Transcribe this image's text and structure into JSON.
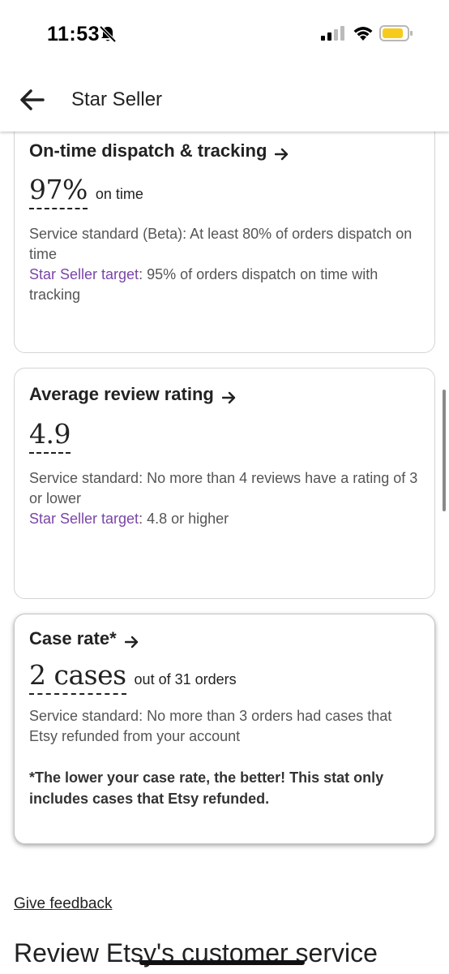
{
  "status_bar": {
    "time": "11:53"
  },
  "header": {
    "title": "Star Seller"
  },
  "cards": [
    {
      "title": "On-time dispatch & tracking",
      "metric_value": "97%",
      "metric_suffix": "on time",
      "standard_label": "Service standard (Beta)",
      "standard_text": ": At least 80% of orders dispatch on time",
      "target_label": "Star Seller target",
      "target_text": ": 95% of orders dispatch on time with tracking"
    },
    {
      "title": "Average review rating",
      "metric_value": "4.9",
      "metric_suffix": "",
      "standard_label": "Service standard",
      "standard_text": ": No more than 4 reviews have a rating of 3 or lower",
      "target_label": "Star Seller target",
      "target_text": ": 4.8 or higher"
    },
    {
      "title": "Case rate*",
      "metric_value": "2 cases",
      "metric_suffix": "out of 31 orders",
      "standard_label": "Service standard",
      "standard_text": ": No more than 3 orders had cases that Etsy refunded from your account",
      "note": "*The lower your case rate, the better! This stat only includes cases that Etsy refunded."
    }
  ],
  "footer": {
    "feedback_link": "Give feedback",
    "section_heading": "Review Etsy's customer service"
  },
  "colors": {
    "accent_purple": "#7a45a8",
    "battery_yellow": "#f7cb1d",
    "text_dark": "#222222",
    "text_muted": "#555555"
  },
  "icons": [
    "bell-slash-icon",
    "signal-icon",
    "wifi-icon",
    "battery-icon",
    "back-arrow-icon",
    "arrow-right-icon"
  ]
}
